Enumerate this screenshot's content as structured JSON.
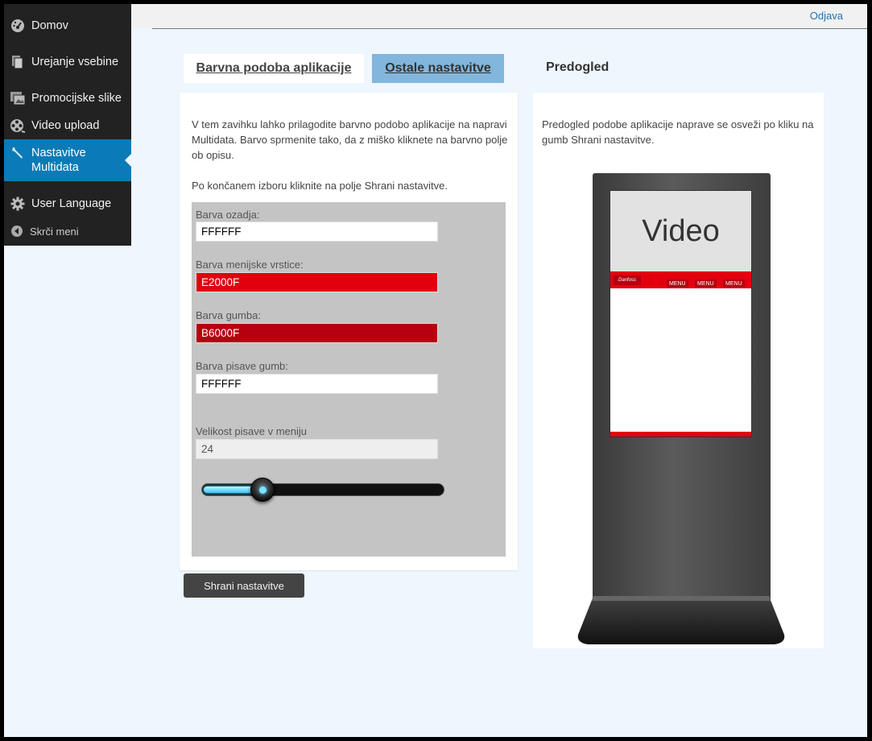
{
  "sidebar": {
    "items": [
      {
        "label": "Domov",
        "icon": "dashboard-icon"
      },
      {
        "label": "Urejanje vsebine",
        "icon": "pages-icon"
      },
      {
        "label": "Promocijske slike",
        "icon": "images-icon"
      },
      {
        "label": "Video upload",
        "icon": "film-icon"
      },
      {
        "label": "Nastavitve Multidata",
        "icon": "wrench-icon"
      },
      {
        "label": "User Language",
        "icon": "gear-icon"
      }
    ],
    "collapse_label": "Skrči meni"
  },
  "topbar": {
    "logout_label": "Odjava"
  },
  "tabs": [
    {
      "label": "Barvna podoba aplikacije"
    },
    {
      "label": "Ostale nastavitve"
    }
  ],
  "preview": {
    "title": "Predogled",
    "description": "Predogled podobe aplikacije naprave se osveži po kliku na gumb Shrani nastavitve.",
    "screen": {
      "video_label": "Video",
      "menu_labels": [
        "MENU",
        "MENU",
        "MENU"
      ]
    }
  },
  "settings": {
    "intro_1": "V tem zavihku lahko prilagodite barvno podobo aplikacije na napravi Multidata. Barvo sprmenite tako, da z miško kliknete na barvno polje ob opisu.",
    "intro_2": "Po končanem izboru kliknite na polje Shrani nastavitve.",
    "fields": {
      "background": {
        "label": "Barva ozadja:",
        "value": "FFFFFF",
        "color": "#FFFFFF",
        "text_color": "#000000"
      },
      "menubar": {
        "label": "Barva menijske vrstice:",
        "value": "E2000F",
        "color": "#E2000F",
        "text_color": "#FFFFFF"
      },
      "button": {
        "label": "Barva gumba:",
        "value": "B6000F",
        "color": "#B6000F",
        "text_color": "#FFFFFF"
      },
      "button_font": {
        "label": "Barva pisave gumb:",
        "value": "FFFFFF",
        "color": "#FFFFFF",
        "text_color": "#000000"
      },
      "menu_font_size": {
        "label": "Velikost pisave v meniju",
        "value": "24"
      }
    },
    "slider_fraction": 0.25
  },
  "save_button_label": "Shrani nastavitve",
  "colors": {
    "sidebar_bg": "#222222",
    "active_menu": "#0A7BB7",
    "tab_active": "#82B6DC",
    "page_bg": "#EEF6FE"
  }
}
